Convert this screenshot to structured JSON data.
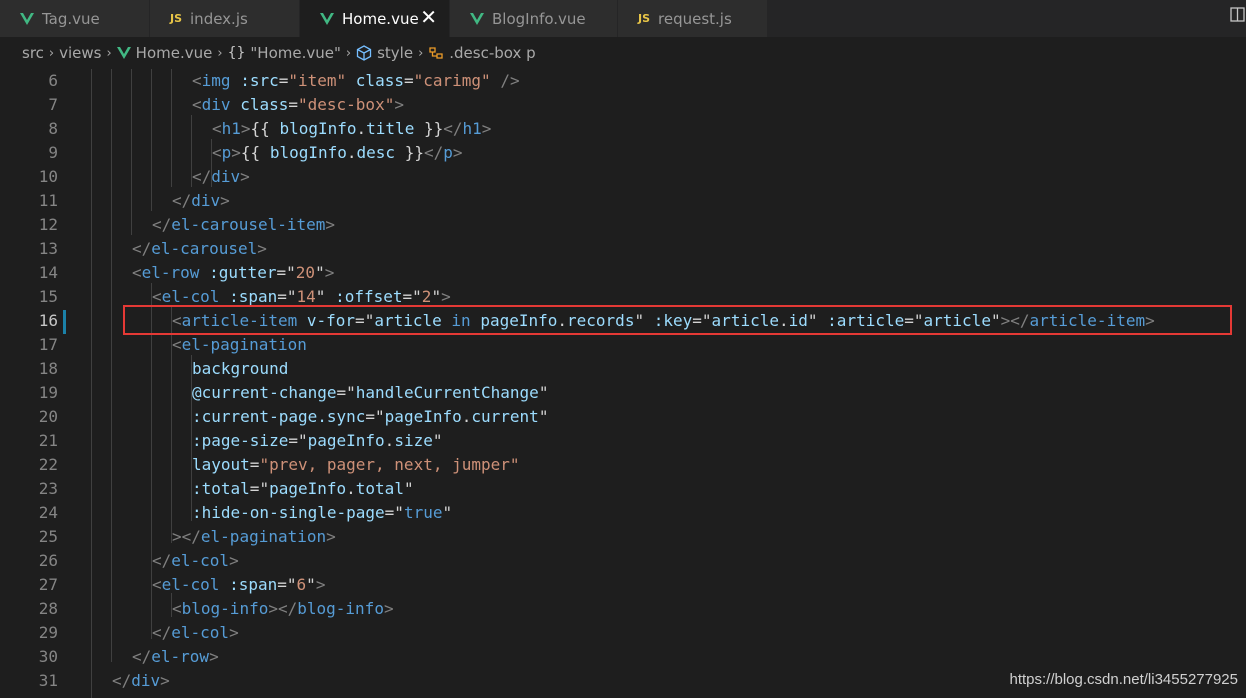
{
  "tabs": [
    {
      "label": "Tag.vue",
      "type": "vue",
      "active": false
    },
    {
      "label": "index.js",
      "type": "js",
      "active": false
    },
    {
      "label": "Home.vue",
      "type": "vue",
      "active": true
    },
    {
      "label": "BlogInfo.vue",
      "type": "vue",
      "active": false
    },
    {
      "label": "request.js",
      "type": "js",
      "active": false
    }
  ],
  "js_badge": "JS",
  "close_glyph": "✕",
  "breadcrumb": {
    "src": "src",
    "views": "views",
    "file": "Home.vue",
    "curly": "{}",
    "component": "\"Home.vue\"",
    "style": "style",
    "selector": ".desc-box p"
  },
  "line_numbers": [
    "6",
    "7",
    "8",
    "9",
    "10",
    "11",
    "12",
    "13",
    "14",
    "15",
    "16",
    "17",
    "18",
    "19",
    "20",
    "21",
    "22",
    "23",
    "24",
    "25",
    "26",
    "27",
    "28",
    "29",
    "30",
    "31"
  ],
  "highlighted_line": "16",
  "watermark": "https://blog.csdn.net/li3455277925",
  "colors": {
    "editor_bg": "#1e1e1e",
    "tag": "#569cd6",
    "attr": "#9cdcfe",
    "string": "#ce9178",
    "highlight_border": "#e53935",
    "vue_green": "#41b883"
  }
}
